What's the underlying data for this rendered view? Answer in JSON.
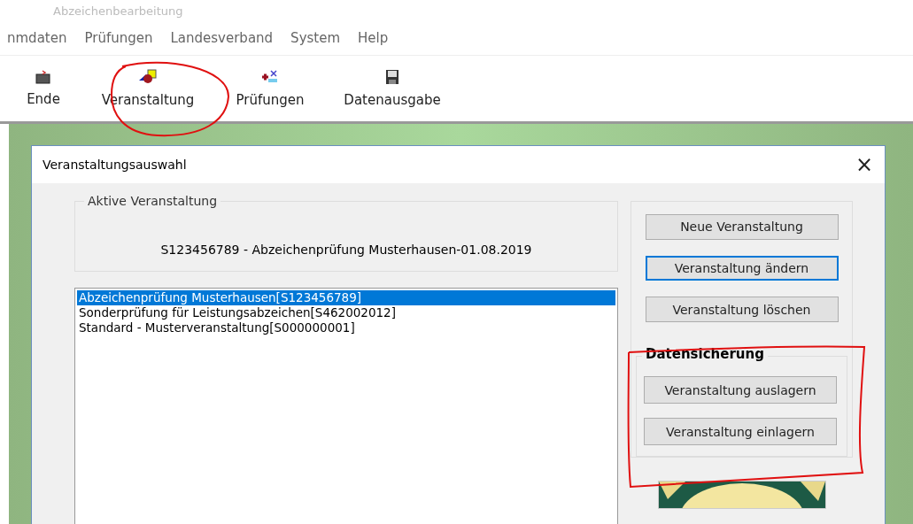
{
  "window": {
    "title": "Abzeichenbearbeitung"
  },
  "menu": [
    {
      "label": "nmdaten"
    },
    {
      "label": "Prüfungen"
    },
    {
      "label": "Landesverband"
    },
    {
      "label": "System"
    },
    {
      "label": "Help"
    }
  ],
  "toolbar": [
    {
      "label": "Ende"
    },
    {
      "label": "Veranstaltung"
    },
    {
      "label": "Prüfungen"
    },
    {
      "label": "Datenausgabe"
    }
  ],
  "dialog": {
    "title": "Veranstaltungsauswahl",
    "close": "×",
    "active_event": {
      "label": "Aktive Veranstaltung",
      "value": "S123456789 - Abzeichenprüfung Musterhausen-01.08.2019"
    },
    "events": [
      {
        "label": "Abzeichenprüfung Musterhausen[S123456789]",
        "selected": true
      },
      {
        "label": "Sonderprüfung für Leistungsabzeichen[S462002012]",
        "selected": false
      },
      {
        "label": "Standard - Musterveranstaltung[S000000001]",
        "selected": false
      }
    ],
    "buttons": [
      {
        "label": "Neue Veranstaltung",
        "focused": false
      },
      {
        "label": "Veranstaltung ändern",
        "focused": true
      },
      {
        "label": "Veranstaltung löschen",
        "focused": false
      }
    ],
    "backup": {
      "label": "Datensicherung",
      "buttons": [
        {
          "label": "Veranstaltung auslagern",
          "focused": false
        },
        {
          "label": "Veranstaltung einlagern",
          "focused": false
        }
      ]
    }
  }
}
